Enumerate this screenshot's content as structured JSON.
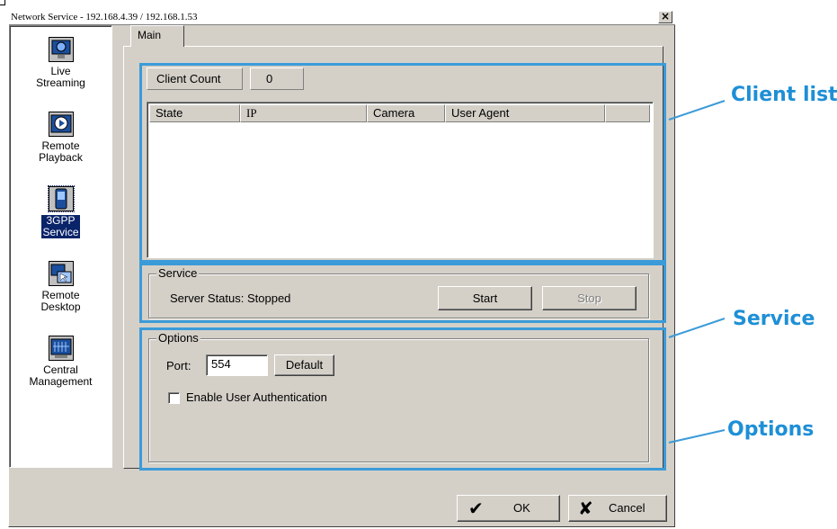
{
  "window": {
    "title": "Network Service - 192.168.4.39 / 192.168.1.53"
  },
  "sidebar": {
    "items": [
      {
        "label": "Live Streaming",
        "icon": "live-streaming-icon"
      },
      {
        "label": "Remote Playback",
        "icon": "remote-playback-icon"
      },
      {
        "label": "3GPP Service",
        "icon": "3gpp-service-icon",
        "active": true
      },
      {
        "label": "Remote Desktop",
        "icon": "remote-desktop-icon"
      },
      {
        "label": "Central Management",
        "icon": "central-management-icon"
      }
    ]
  },
  "tabs": [
    {
      "label": "Main",
      "active": true
    }
  ],
  "client_list": {
    "count_label": "Client Count",
    "count_value": "0",
    "columns": [
      "State",
      "IP",
      "Camera",
      "User Agent"
    ],
    "rows": []
  },
  "service": {
    "group_title": "Service",
    "status_text": "Server Status: Stopped",
    "start_label": "Start",
    "stop_label": "Stop"
  },
  "options": {
    "group_title": "Options",
    "port_label": "Port:",
    "port_value": "554",
    "default_label": "Default",
    "auth_label": "Enable User Authentication",
    "auth_checked": false
  },
  "footer": {
    "ok_label": "OK",
    "cancel_label": "Cancel"
  },
  "annotations": {
    "client_list": "Client list",
    "service": "Service",
    "options": "Options"
  },
  "colors": {
    "annotation": "#1e8fd6",
    "highlight": "#3b9bd9",
    "dialog": "#d4d0c8",
    "selection": "#0a246a"
  }
}
